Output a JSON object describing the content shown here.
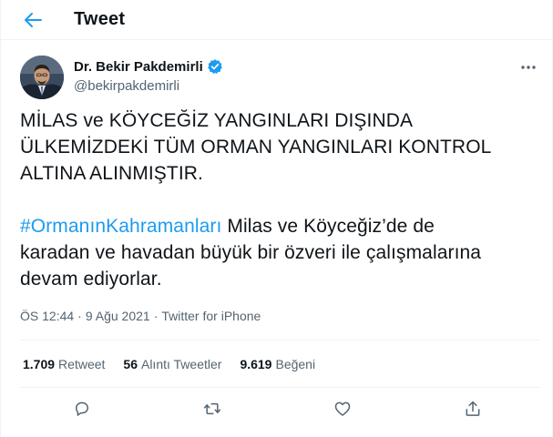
{
  "header": {
    "back_icon": "arrow-left-icon",
    "title": "Tweet"
  },
  "author": {
    "display_name": "Dr. Bekir Pakdemirli",
    "handle": "@bekirpakdemirli",
    "verified_icon": "verified-badge-icon",
    "more_icon": "more-horizontal-icon"
  },
  "tweet": {
    "line1": "MİLAS ve KÖYCEĞİZ YANGINLARI DIŞINDA",
    "line2": "ÜLKEMİZDEKİ TÜM ORMAN YANGINLARI KONTROL",
    "line3": "ALTINA ALINMIŞTIR.",
    "hashtag": "#OrmanınKahramanları",
    "body_after_hashtag": " Milas ve Köyceğiz’de de",
    "line5": "karadan ve havadan büyük bir özveri ile çalışmalarına",
    "line6": "devam ediyorlar."
  },
  "meta": {
    "time": "ÖS 12:44",
    "sep1": "·",
    "date": "9 Ağu 2021",
    "sep2": "·",
    "source": "Twitter for iPhone"
  },
  "stats": {
    "retweets_count": "1.709",
    "retweets_label": "Retweet",
    "quotes_count": "56",
    "quotes_label": "Alıntı Tweetler",
    "likes_count": "9.619",
    "likes_label": "Beğeni"
  },
  "actions": {
    "reply_icon": "reply-icon",
    "retweet_icon": "retweet-icon",
    "like_icon": "heart-icon",
    "share_icon": "share-icon"
  },
  "colors": {
    "accent": "#1d9bf0",
    "text": "#0f1419",
    "secondary": "#536471",
    "divider": "#eff3f4"
  }
}
